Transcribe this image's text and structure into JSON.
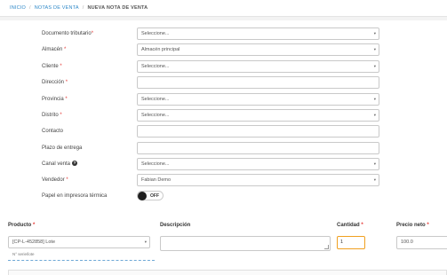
{
  "breadcrumb": {
    "items": [
      "INICIO",
      "NOTAS DE VENTA"
    ],
    "current": "NUEVA NOTA DE VENTA",
    "separator": "/"
  },
  "form": {
    "documento": {
      "label": "Documento tributario",
      "req": "*",
      "value": "Seleccione..."
    },
    "almacen": {
      "label": "Almacén",
      "req": "*",
      "value": "Almacén principal"
    },
    "cliente": {
      "label": "Cliente",
      "req": "*",
      "value": "Seleccione..."
    },
    "direccion": {
      "label": "Dirección",
      "req": "*",
      "value": ""
    },
    "provincia": {
      "label": "Provincia",
      "req": "*",
      "value": "Seleccione..."
    },
    "distrito": {
      "label": "Distrito",
      "req": "*",
      "value": "Seleccione..."
    },
    "contacto": {
      "label": "Contacto",
      "value": ""
    },
    "plazo": {
      "label": "Plazo de entrega",
      "value": ""
    },
    "canal": {
      "label": "Canal venta",
      "help": "?",
      "value": "Seleccione..."
    },
    "vendedor": {
      "label": "Vendedor",
      "req": "*",
      "value": "Fabian Demo"
    },
    "papel": {
      "label": "Papel en impresora térmica",
      "toggle": "OFF"
    }
  },
  "items": {
    "headers": {
      "producto": "Producto",
      "descripcion": "Descripción",
      "cantidad": "Cantidad",
      "precio": "Precio neto"
    },
    "req": "*",
    "producto_value": "[CP-L-452858] Lote",
    "serie_label": "N° serie/lote",
    "cantidad_value": "1",
    "precio_value": "100.0"
  },
  "icons": {
    "caret": "chevron-down-icon",
    "help": "help-circle-icon"
  },
  "colors": {
    "accent": "#2e88c8",
    "required": "#e53935",
    "focus": "#f0a020"
  }
}
